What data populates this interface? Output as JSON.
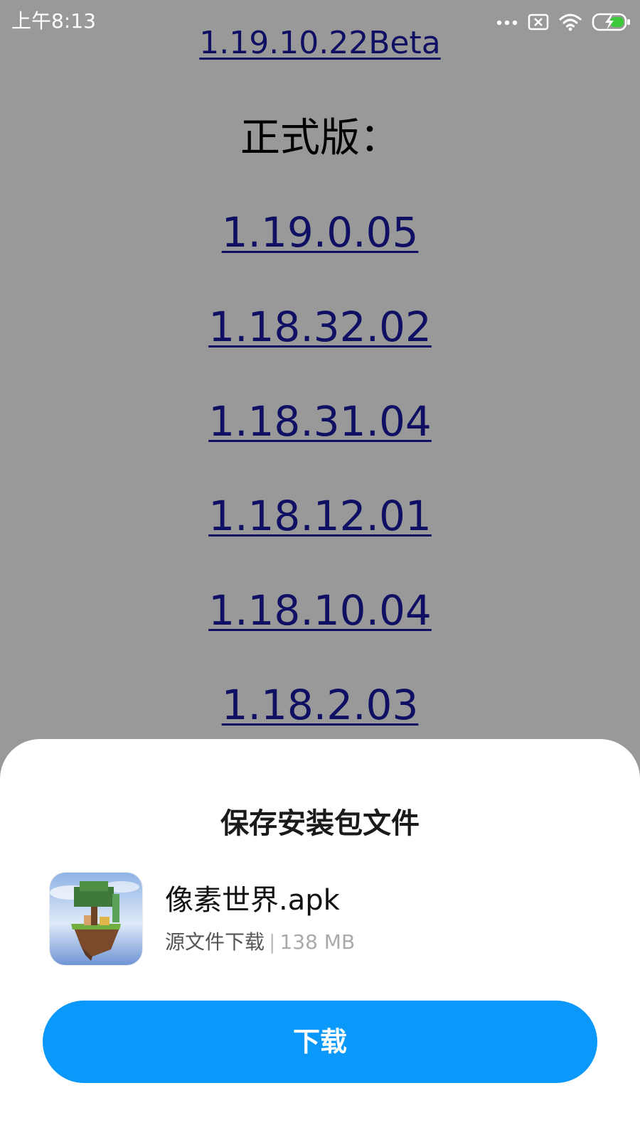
{
  "status_bar": {
    "time": "上午8:13",
    "icons": [
      "more-dots-icon",
      "sim-blocked-icon",
      "wifi-icon",
      "battery-charging-icon"
    ]
  },
  "page": {
    "top_link": "1.19.10.22Beta",
    "section_heading": "正式版：",
    "version_links": [
      "1.19.0.05",
      "1.18.32.02",
      "1.18.31.04",
      "1.18.12.01",
      "1.18.10.04",
      "1.18.2.03"
    ]
  },
  "sheet": {
    "title": "保存安装包文件",
    "file_name": "像素世界.apk",
    "source": "源文件下载",
    "separator": "|",
    "size": "138 MB",
    "download_label": "下载"
  },
  "colors": {
    "link": "#1a1aa6",
    "overlay": "rgba(0,0,0,0.40)",
    "button": "#0a98fb"
  }
}
